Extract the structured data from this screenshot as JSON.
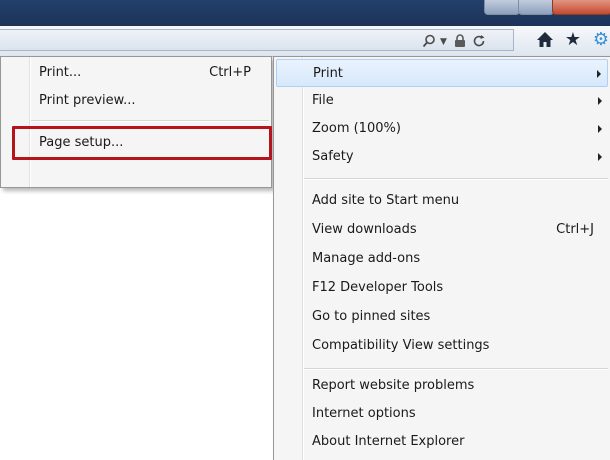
{
  "toolbar": {
    "search_icon": "search-icon",
    "dropdown_icon": "dropdown-arrow-icon",
    "lock_icon": "lock-icon",
    "refresh_icon": "refresh-icon",
    "home_icon": "home-icon",
    "favorites_icon": "star-icon",
    "tools_icon": "gear-icon"
  },
  "print_submenu": {
    "items": [
      {
        "label": "Print...",
        "shortcut": "Ctrl+P"
      },
      {
        "label": "Print preview...",
        "shortcut": ""
      },
      {
        "label": "Page setup...",
        "shortcut": ""
      }
    ]
  },
  "tools_menu": {
    "group1": [
      {
        "label": "Print",
        "submenu": true
      },
      {
        "label": "File",
        "submenu": true
      },
      {
        "label": "Zoom (100%)",
        "submenu": true
      },
      {
        "label": "Safety",
        "submenu": true
      }
    ],
    "group2": [
      {
        "label": "Add site to Start menu",
        "shortcut": ""
      },
      {
        "label": "View downloads",
        "shortcut": "Ctrl+J"
      },
      {
        "label": "Manage add-ons",
        "shortcut": ""
      },
      {
        "label": "F12 Developer Tools",
        "shortcut": ""
      },
      {
        "label": "Go to pinned sites",
        "shortcut": ""
      },
      {
        "label": "Compatibility View settings",
        "shortcut": ""
      }
    ],
    "group3": [
      {
        "label": "Report website problems",
        "shortcut": ""
      },
      {
        "label": "Internet options",
        "shortcut": ""
      },
      {
        "label": "About Internet Explorer",
        "shortcut": ""
      }
    ]
  },
  "colors": {
    "highlight_annotation": "#b5141c",
    "menu_hover_bg": "#d6e8fb",
    "titlebar": "#1b3358"
  }
}
